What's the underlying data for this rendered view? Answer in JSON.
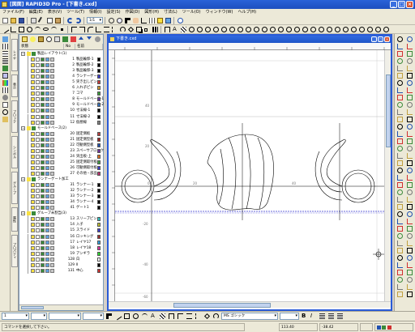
{
  "app": {
    "title": "[図面] RAPID3D Pro - [下書き.cxd]"
  },
  "window_buttons": [
    "_",
    "□",
    "×"
  ],
  "menu": [
    "ファイル(F)",
    "編集(E)",
    "表示(V)",
    "ツール(T)",
    "情報(I)",
    "設定(S)",
    "作図(D)",
    "図形(H)",
    "寸法(L)",
    "ツール(O)",
    "ウィンドウ(W)",
    "ヘルプ(H)"
  ],
  "toolbar_zoom": "1/1",
  "layer_panel": {
    "headers": [
      "状態",
      "No",
      "名前"
    ],
    "rows": [
      {
        "type": "group",
        "label": "製品レイアウト(1)",
        "color": ""
      },
      {
        "type": "layer",
        "num": "1",
        "name": "製品輪郭-1",
        "color": "#000000"
      },
      {
        "type": "layer",
        "num": "2",
        "name": "製品輪郭-2",
        "color": "#000000"
      },
      {
        "type": "layer",
        "num": "3",
        "name": "製品輪郭-3",
        "color": "#000000"
      },
      {
        "type": "layer",
        "num": "4",
        "name": "ランナーゲート",
        "color": "#3a3ad0"
      },
      {
        "type": "layer",
        "num": "5",
        "name": "突き出しピン",
        "color": "#d03a3a"
      },
      {
        "type": "layer",
        "num": "6",
        "name": "入れ子ピン",
        "color": "#d09a30"
      },
      {
        "type": "layer",
        "num": "7",
        "name": "コマ",
        "color": "#3aa03a"
      },
      {
        "type": "layer",
        "num": "8",
        "name": "モールドベース-1",
        "color": "#6030a0"
      },
      {
        "type": "layer",
        "num": "9",
        "name": "モールドベース-2",
        "color": "#3070c0"
      },
      {
        "type": "layer",
        "num": "10",
        "name": "寸法線-1",
        "color": "#000000"
      },
      {
        "type": "layer",
        "num": "11",
        "name": "寸法線-2",
        "color": "#000000"
      },
      {
        "type": "layer",
        "num": "12",
        "name": "仮想線",
        "color": "#808080"
      },
      {
        "type": "group",
        "label": "モールドベース(2)",
        "color": ""
      },
      {
        "type": "layer",
        "num": "20",
        "name": "固定側板",
        "color": "#c04040"
      },
      {
        "type": "layer",
        "num": "21",
        "name": "固定側型板",
        "color": "#a02020"
      },
      {
        "type": "layer",
        "num": "22",
        "name": "可動側型板",
        "color": "#2050b0"
      },
      {
        "type": "layer",
        "num": "23",
        "name": "スペーサブロック",
        "color": "#7030a0"
      },
      {
        "type": "layer",
        "num": "24",
        "name": "突出板-上",
        "color": "#e07020"
      },
      {
        "type": "layer",
        "num": "25",
        "name": "固定側取付板",
        "color": "#40a040"
      },
      {
        "type": "layer",
        "num": "26",
        "name": "可動側取付板",
        "color": "#3a3ad0"
      },
      {
        "type": "layer",
        "num": "27",
        "name": "その他・部品",
        "color": "#c03070"
      },
      {
        "type": "group",
        "label": "ランナーゲート加工",
        "color": ""
      },
      {
        "type": "layer",
        "num": "31",
        "name": "ランナー-1",
        "color": "#000000"
      },
      {
        "type": "layer",
        "num": "32",
        "name": "ランナー-2",
        "color": "#000000"
      },
      {
        "type": "layer",
        "num": "33",
        "name": "ランナー-3",
        "color": "#000000"
      },
      {
        "type": "layer",
        "num": "34",
        "name": "ランナー-4",
        "color": "#000000"
      },
      {
        "type": "layer",
        "num": "41",
        "name": "ゲート1",
        "color": "#000000"
      },
      {
        "type": "group",
        "label": "グループ未割当(3)",
        "color": ""
      },
      {
        "type": "layer",
        "num": "13",
        "name": "スリーブピン",
        "color": "#30c0c0"
      },
      {
        "type": "layer",
        "num": "14",
        "name": "入子",
        "color": "#c0c030"
      },
      {
        "type": "layer",
        "num": "15",
        "name": "スライド",
        "color": "#3a3ad0"
      },
      {
        "type": "layer",
        "num": "16",
        "name": "ロッキング",
        "color": "#a03030"
      },
      {
        "type": "layer",
        "num": "17",
        "name": "レイヤ17",
        "color": "#30a0e0"
      },
      {
        "type": "layer",
        "num": "18",
        "name": "レイヤ18",
        "color": "#e030a0"
      },
      {
        "type": "layer",
        "num": "19",
        "name": "アンギラ",
        "color": "#30e030"
      },
      {
        "type": "layer",
        "num": "128",
        "name": "白",
        "color": "#ffffff"
      },
      {
        "type": "layer",
        "num": "129",
        "name": "Ⅱ",
        "color": "#000000"
      },
      {
        "type": "layer",
        "num": "131",
        "name": "中心",
        "color": "#d03030"
      }
    ]
  },
  "side_tabs": [
    "レイヤ",
    "表示",
    "ブロック",
    "シンボル",
    "グループ",
    "属性",
    "プロパティ"
  ],
  "document": {
    "title": "下書き.cxd"
  },
  "canvas": {
    "y_labels": [
      "40",
      "20",
      "0",
      "-20",
      "-40",
      "-60"
    ],
    "x_labels": [
      "20",
      "40"
    ]
  },
  "bottom": {
    "combo_layer": "1",
    "combo_line": "",
    "combo_font": "MS ゴシック",
    "combo_size": ""
  },
  "status": {
    "message": "コマンドを選択して下さい。",
    "coord_x": "113.40",
    "coord_y": "-38.42"
  },
  "colors": {
    "accent": "#2a5bd7",
    "selection": "#316ac5"
  }
}
